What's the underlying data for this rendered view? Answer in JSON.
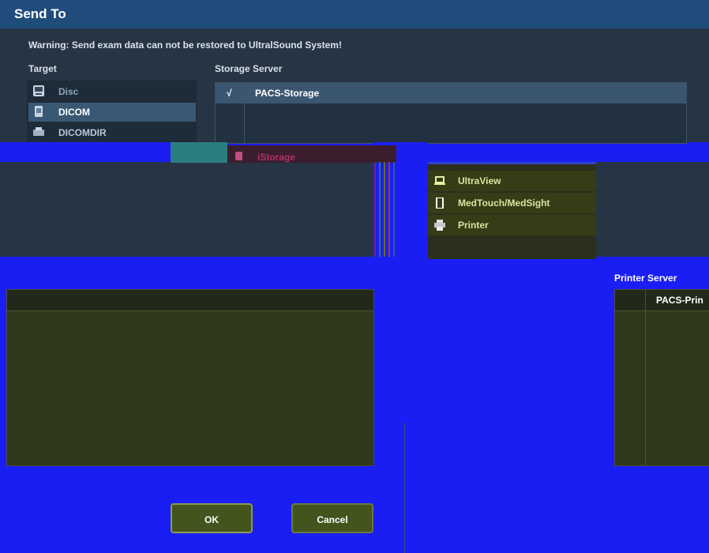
{
  "dialog": {
    "title": "Send To",
    "warning": "Warning: Send exam data can not be restored to UltralSound System!",
    "target_header": "Target",
    "storage_header": "Storage Server",
    "printer_header": "Printer Server"
  },
  "targets": [
    {
      "label": "Disc",
      "icon": "disc-icon",
      "selected": false
    },
    {
      "label": "DICOM",
      "icon": "dicom-icon",
      "selected": true
    },
    {
      "label": "DICOMDIR",
      "icon": "dicomdir-icon",
      "selected": false
    },
    {
      "label": "iStorage",
      "icon": "istorage-icon",
      "selected": false
    },
    {
      "label": "UltraView",
      "icon": "laptop-icon",
      "selected": false
    },
    {
      "label": "MedTouch/MedSight",
      "icon": "tablet-icon",
      "selected": false
    },
    {
      "label": "Printer",
      "icon": "printer-icon",
      "selected": false
    }
  ],
  "storage_servers": [
    {
      "check": "√",
      "name": "PACS-Storage"
    }
  ],
  "printer_servers": [
    {
      "name": "PACS-Prin"
    }
  ],
  "buttons": {
    "ok": "OK",
    "cancel": "Cancel"
  },
  "colors": {
    "background_blue": "#1a1ef2",
    "title_bar": "#1f4c7a",
    "panel_dark": "#263444",
    "olive": "#353d16",
    "accent_text": "#dde2a0"
  }
}
